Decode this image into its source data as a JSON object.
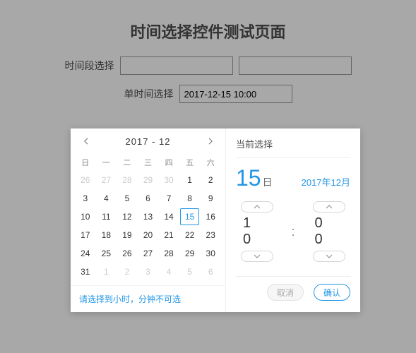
{
  "page": {
    "title": "时间选择控件测试页面",
    "range_label": "时间段选择",
    "single_label": "单时间选择",
    "single_value": "2017-12-15 10:00"
  },
  "calendar": {
    "header": "2017 - 12",
    "dow": [
      "日",
      "一",
      "二",
      "三",
      "四",
      "五",
      "六"
    ],
    "weeks": [
      [
        {
          "d": "26",
          "o": true
        },
        {
          "d": "27",
          "o": true
        },
        {
          "d": "28",
          "o": true
        },
        {
          "d": "29",
          "o": true
        },
        {
          "d": "30",
          "o": true
        },
        {
          "d": "1"
        },
        {
          "d": "2"
        }
      ],
      [
        {
          "d": "3"
        },
        {
          "d": "4"
        },
        {
          "d": "5"
        },
        {
          "d": "6"
        },
        {
          "d": "7"
        },
        {
          "d": "8"
        },
        {
          "d": "9"
        }
      ],
      [
        {
          "d": "10"
        },
        {
          "d": "11"
        },
        {
          "d": "12"
        },
        {
          "d": "13"
        },
        {
          "d": "14"
        },
        {
          "d": "15",
          "sel": true
        },
        {
          "d": "16"
        }
      ],
      [
        {
          "d": "17"
        },
        {
          "d": "18"
        },
        {
          "d": "19"
        },
        {
          "d": "20"
        },
        {
          "d": "21"
        },
        {
          "d": "22"
        },
        {
          "d": "23"
        }
      ],
      [
        {
          "d": "24"
        },
        {
          "d": "25"
        },
        {
          "d": "26"
        },
        {
          "d": "27"
        },
        {
          "d": "28"
        },
        {
          "d": "29"
        },
        {
          "d": "30"
        }
      ],
      [
        {
          "d": "31"
        },
        {
          "d": "1",
          "o": true
        },
        {
          "d": "2",
          "o": true
        },
        {
          "d": "3",
          "o": true
        },
        {
          "d": "4",
          "o": true
        },
        {
          "d": "5",
          "o": true
        },
        {
          "d": "6",
          "o": true
        }
      ]
    ],
    "hint": "请选择到小时，分钟不可选"
  },
  "time": {
    "current_label": "当前选择",
    "day": "15",
    "day_suffix": "日",
    "ym": "2017年12月",
    "hour": "1 0",
    "minute": "0 0",
    "cancel": "取消",
    "confirm": "确认"
  }
}
